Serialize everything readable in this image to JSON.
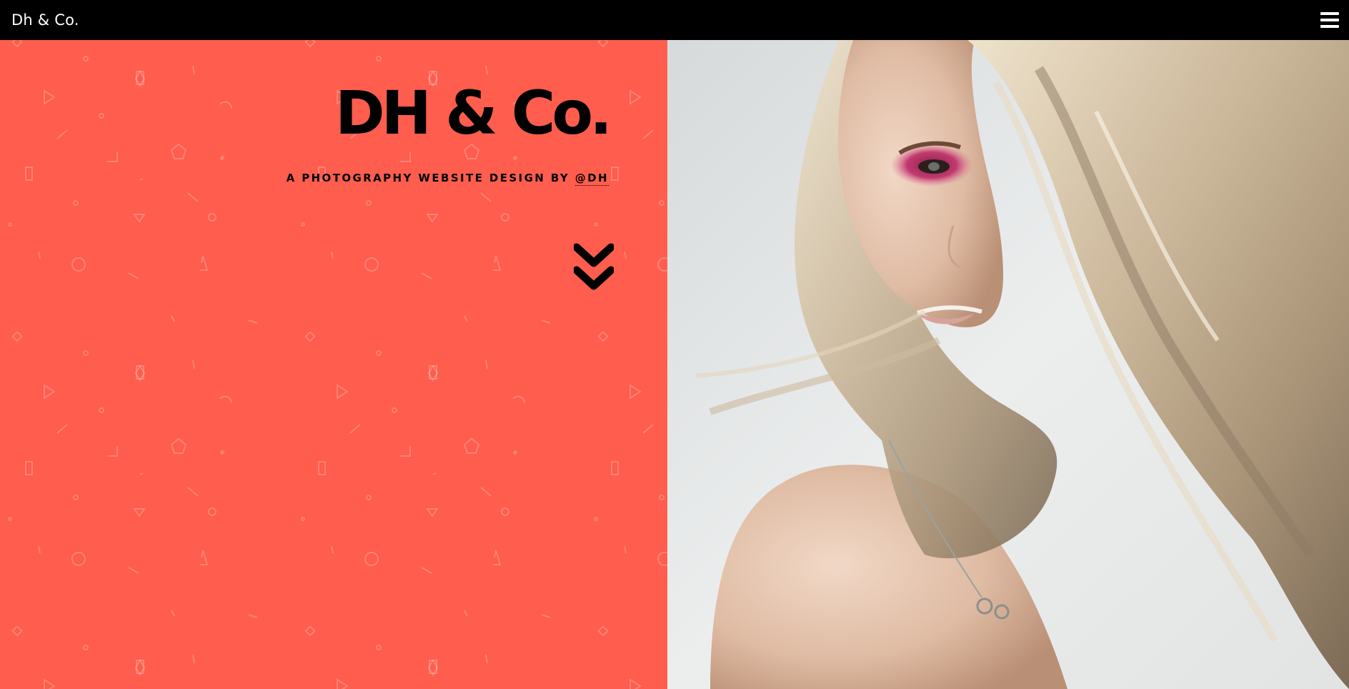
{
  "header": {
    "brand": "Dh & Co.",
    "menu_icon": "hamburger-menu-icon"
  },
  "hero": {
    "title": "DH & Co.",
    "subtitle_prefix": "A PHOTOGRAPHY WEBSITE DESIGN BY ",
    "subtitle_link": "@DH",
    "scroll_icon": "double-chevron-down-icon",
    "accent_color": "#ff5d4d"
  },
  "photo": {
    "subject": "portrait of blonde woman with pink eye makeup and flowing hair"
  }
}
